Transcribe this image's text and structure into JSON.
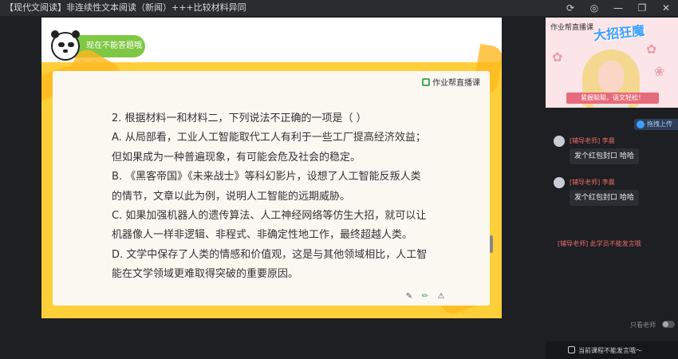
{
  "window": {
    "title": "【现代文阅读】非连续性文本阅读（新闻）+++比较材料异同",
    "buttons": [
      "⟳",
      "◎",
      "—",
      "❐",
      "✕"
    ]
  },
  "stage": {
    "badge_label": "现在不能答题哦",
    "brand": "作业帮直播课",
    "question": [
      "2. 根据材料一和材料二，下列说法不正确的一项是（    ）",
      "A. 从局部看，工业人工智能取代工人有利于一些工厂提高经济效益；",
      "但如果成为一种普遍现象，有可能会危及社会的稳定。",
      "B. 《黑客帝国》《未来战士》等科幻影片，设想了人工智能反叛人类",
      "的情节，文章以此为例，说明人工智能的远期威胁。",
      "C. 如果加强机器人的遗传算法、人工神经网络等仿生大招，就可以让",
      "机器像人一样非逻辑、非程式、非确定性地工作，最终超越人类。",
      "D. 文学中保存了人类的情感和价值观，这是与其他领域相比，人工智",
      "能在文学领域更难取得突破的重要原因。"
    ],
    "tools": [
      "✎",
      "✏",
      "⚠"
    ]
  },
  "video": {
    "brand": "作业帮直播课",
    "title": "大招狂魔",
    "caption": "紧握聪聪，语文轻松！"
  },
  "drag_button": "拖拽上传",
  "chat": {
    "messages": [
      {
        "sender": "[辅导老师] 李晨",
        "text": "发个红包封口 哈哈"
      },
      {
        "sender": "[辅导老师] 李晨",
        "text": "发个红包封口 哈哈"
      }
    ],
    "third_sender": "[辅导老师] 此学员不能发言哦"
  },
  "only_teacher_label": "只看老师",
  "bottom_notice": "当前课程不能发言哦～",
  "colors": {
    "accent_green": "#7fc843",
    "stage_yellow": "#ffcf3a",
    "chat_red": "#e56b6b"
  }
}
